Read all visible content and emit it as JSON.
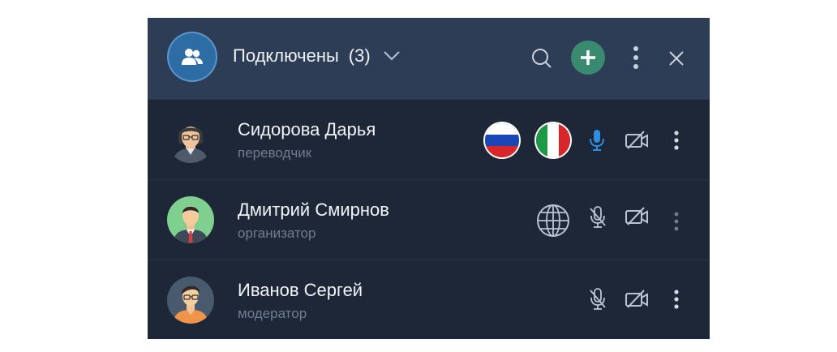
{
  "header": {
    "title": "Подключены",
    "count": "(3)",
    "icons": [
      "users-icon",
      "chevron-down-icon",
      "search-icon",
      "plus-icon",
      "more-vertical-icon",
      "close-icon"
    ]
  },
  "participants": [
    {
      "name": "Сидорова Дарья",
      "role": "переводчик",
      "languages": [
        "flag-russia-icon",
        "flag-italy-icon"
      ],
      "mic": "microphone-on",
      "camera": "camera-off"
    },
    {
      "name": "Дмитрий Смирнов",
      "role": "организатор",
      "languages": [
        "globe-icon"
      ],
      "mic": "microphone-off",
      "camera": "camera-off"
    },
    {
      "name": "Иванов Сергей",
      "role": "модератор",
      "languages": [],
      "mic": "microphone-off",
      "camera": "camera-off"
    }
  ],
  "colors": {
    "panel_bg": "#1d2737",
    "header_bg": "#2d3d55",
    "accent_blue": "#2f8ee0",
    "add_button": "#3a8a70",
    "muted_text": "#6f7d92"
  }
}
